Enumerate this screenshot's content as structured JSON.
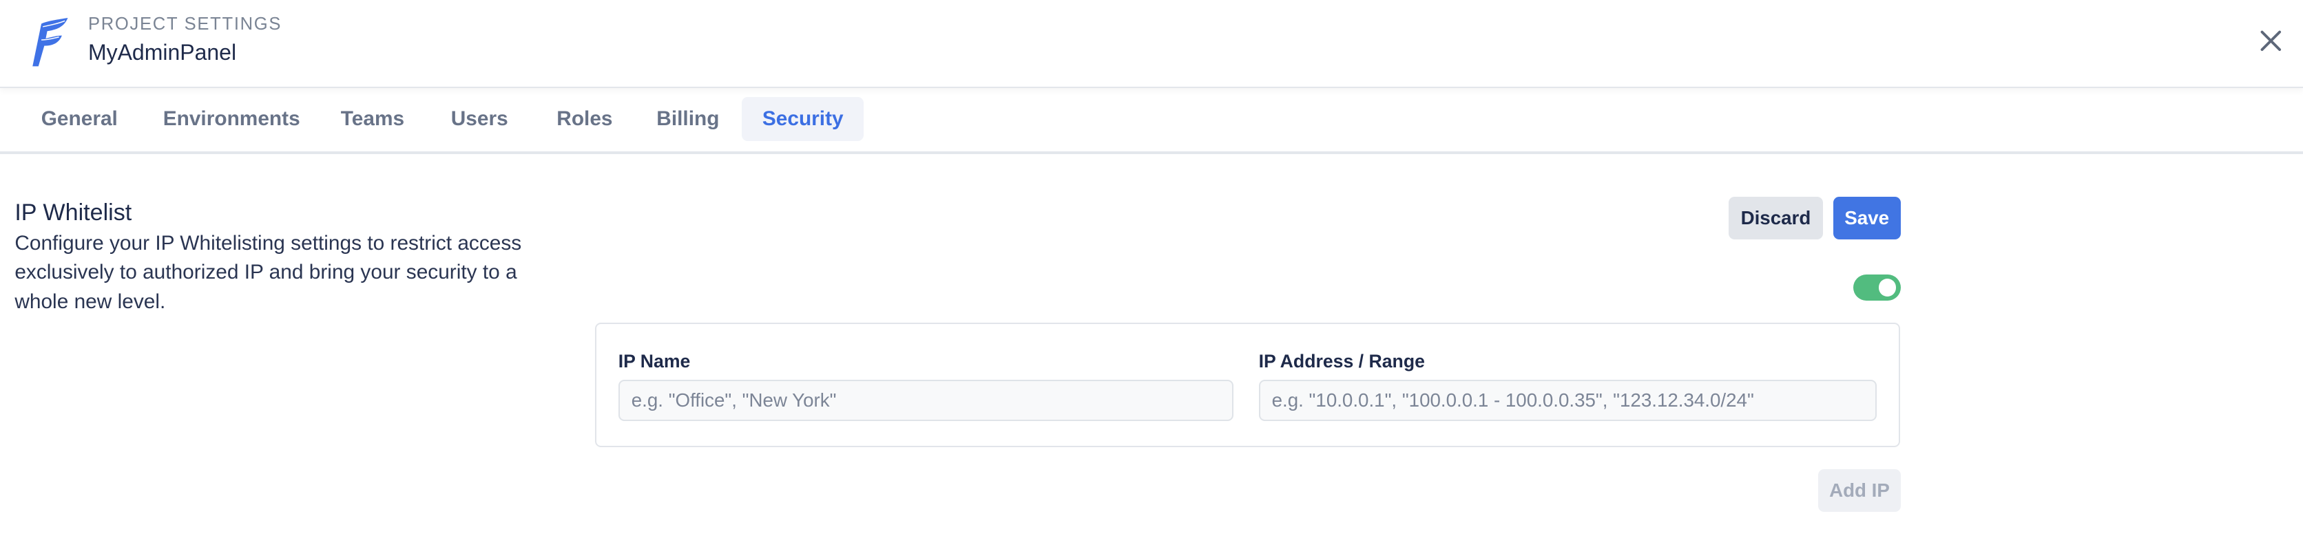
{
  "header": {
    "eyebrow": "PROJECT SETTINGS",
    "project_name": "MyAdminPanel",
    "logo_icon": "feather-f-logo",
    "close_icon": "close-x-icon"
  },
  "tabs": [
    {
      "label": "General",
      "active": false
    },
    {
      "label": "Environments",
      "active": false
    },
    {
      "label": "Teams",
      "active": false
    },
    {
      "label": "Users",
      "active": false
    },
    {
      "label": "Roles",
      "active": false
    },
    {
      "label": "Billing",
      "active": false
    },
    {
      "label": "Security",
      "active": true
    }
  ],
  "section": {
    "title": "IP Whitelist",
    "description": "Configure your IP Whitelisting settings to restrict access exclusively to authorized IP and bring your security to a whole new level."
  },
  "actions": {
    "discard_label": "Discard",
    "save_label": "Save"
  },
  "toggle": {
    "enabled": true
  },
  "form": {
    "ip_name": {
      "label": "IP Name",
      "value": "",
      "placeholder": "e.g. \"Office\", \"New York\""
    },
    "ip_address": {
      "label": "IP Address / Range",
      "value": "",
      "placeholder": "e.g. \"10.0.0.1\", \"100.0.0.1 - 100.0.0.35\", \"123.12.34.0/24\""
    },
    "add_label": "Add IP"
  },
  "colors": {
    "accent": "#4175e3",
    "toggle_on": "#52bc7f",
    "text": "#1e2a4a"
  }
}
